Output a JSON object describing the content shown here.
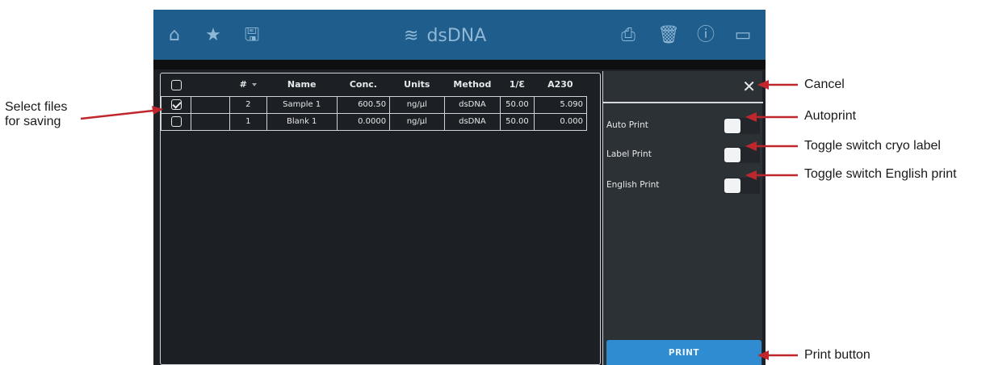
{
  "topbar": {
    "title": "dsDNA",
    "icons": {
      "home": "home-icon",
      "favorite": "star-icon",
      "save": "save-icon",
      "dna": "dna-icon",
      "print": "printer-icon",
      "delete": "trash-icon",
      "info": "info-icon",
      "battery": "battery-icon"
    },
    "glyphs": {
      "home": "⌂",
      "favorite": "★",
      "save": "🖫",
      "dna": "≋",
      "print": "⎙",
      "delete": "🗑",
      "info": "ⓘ",
      "battery": "▭"
    }
  },
  "table": {
    "columns": [
      "",
      "#",
      "Name",
      "Conc.",
      "Units",
      "Method",
      "1/Ɛ",
      "A230"
    ],
    "rows": [
      {
        "checked": true,
        "num": "2",
        "name": "Sample 1",
        "conc": "600.50",
        "units": "ng/µl",
        "method": "dsDNA",
        "inv_e": "50.00",
        "a230": "5.090"
      },
      {
        "checked": false,
        "num": "1",
        "name": "Blank 1",
        "conc": "0.0000",
        "units": "ng/µl",
        "method": "dsDNA",
        "inv_e": "50.00",
        "a230": "0.000"
      }
    ]
  },
  "print_panel": {
    "close_glyph": "✕",
    "options": [
      {
        "label": "Auto Print",
        "on": false
      },
      {
        "label": "Label Print",
        "on": false
      },
      {
        "label": "English Print",
        "on": false
      }
    ],
    "print_label": "PRINT"
  },
  "callouts": {
    "select_files_line1": "Select files",
    "select_files_line2": "for saving",
    "cancel": "Cancel",
    "autoprint": "Autoprint",
    "label": "Toggle switch cryo label",
    "english": "Toggle switch English print",
    "print_button": "Print button"
  },
  "colors": {
    "header": "#1e5d8c",
    "screen": "#1d2024",
    "panel": "#2c3136",
    "print_button": "#2f8cd0",
    "arrow": "#c0272d"
  }
}
